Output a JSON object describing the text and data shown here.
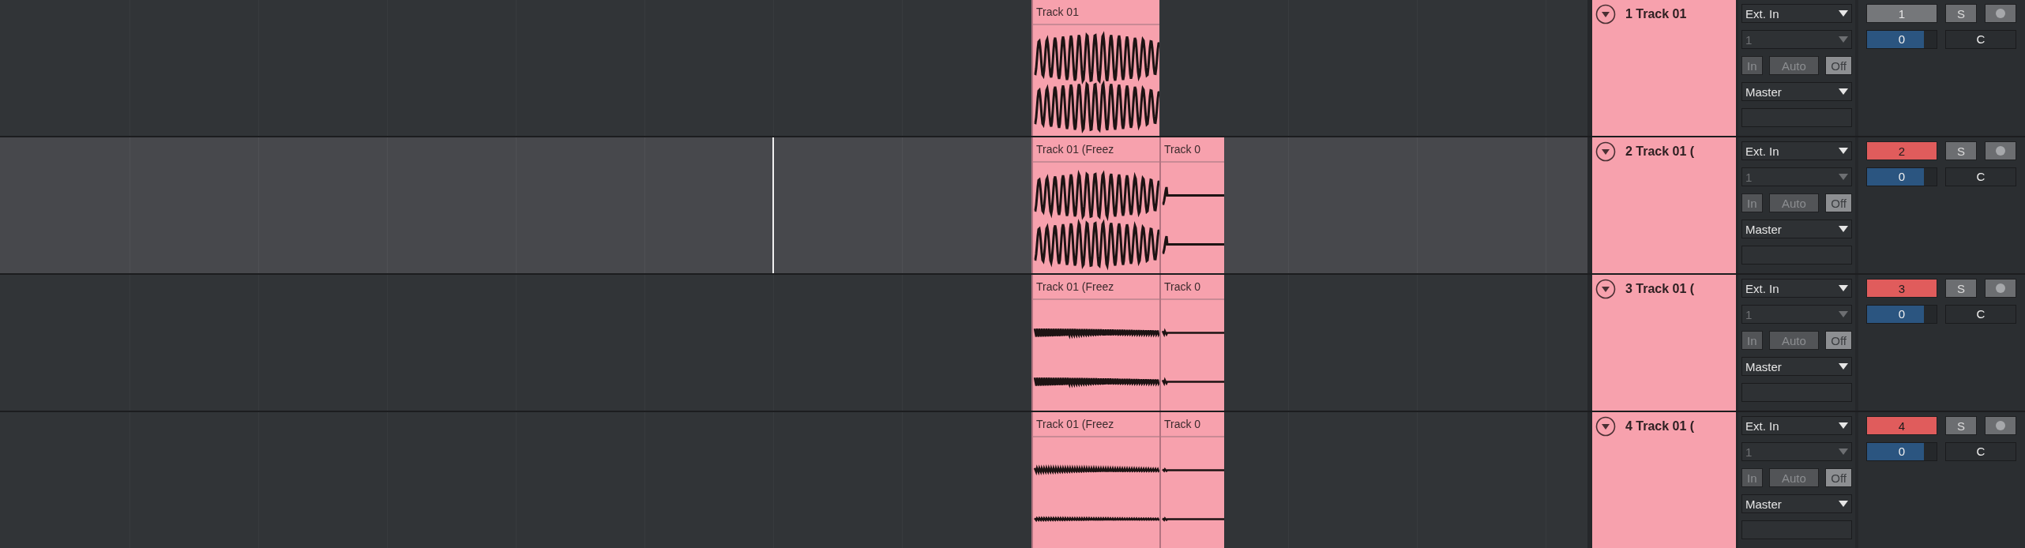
{
  "tracks": [
    {
      "name": "1 Track 01",
      "selected": false,
      "highlighted": false,
      "number": "1",
      "clips": [
        "Track 01"
      ],
      "input": "Ext. In",
      "channel": "1",
      "monitor": [
        {
          "label": "In",
          "selected": false
        },
        {
          "label": "Auto",
          "selected": false
        },
        {
          "label": "Off",
          "selected": true
        }
      ],
      "output": "Master",
      "solo": "S",
      "volume": {
        "value": "0",
        "level": 0.82
      },
      "pan": "C"
    },
    {
      "name": "2 Track 01 (",
      "selected": true,
      "highlighted": true,
      "number": "2",
      "clips": [
        "Track 01 (Freez",
        "Track 0"
      ],
      "input": "Ext. In",
      "channel": "1",
      "monitor": [
        {
          "label": "In",
          "selected": false
        },
        {
          "label": "Auto",
          "selected": false
        },
        {
          "label": "Off",
          "selected": true
        }
      ],
      "output": "Master",
      "solo": "S",
      "volume": {
        "value": "0",
        "level": 0.82
      },
      "pan": "C"
    },
    {
      "name": "3 Track 01 (",
      "selected": false,
      "highlighted": true,
      "number": "3",
      "clips": [
        "Track 01 (Freez",
        "Track 0"
      ],
      "input": "Ext. In",
      "channel": "1",
      "monitor": [
        {
          "label": "In",
          "selected": false
        },
        {
          "label": "Auto",
          "selected": false
        },
        {
          "label": "Off",
          "selected": true
        }
      ],
      "output": "Master",
      "solo": "S",
      "volume": {
        "value": "0",
        "level": 0.82
      },
      "pan": "C"
    },
    {
      "name": "4 Track 01 (",
      "selected": false,
      "highlighted": true,
      "number": "4",
      "clips": [
        "Track 01 (Freez",
        "Track 0"
      ],
      "input": "Ext. In",
      "channel": "1",
      "monitor": [
        {
          "label": "In",
          "selected": false
        },
        {
          "label": "Auto",
          "selected": false
        },
        {
          "label": "Off",
          "selected": true
        }
      ],
      "output": "Master",
      "solo": "S",
      "volume": {
        "value": "0",
        "level": 0.82
      },
      "pan": "C"
    }
  ]
}
